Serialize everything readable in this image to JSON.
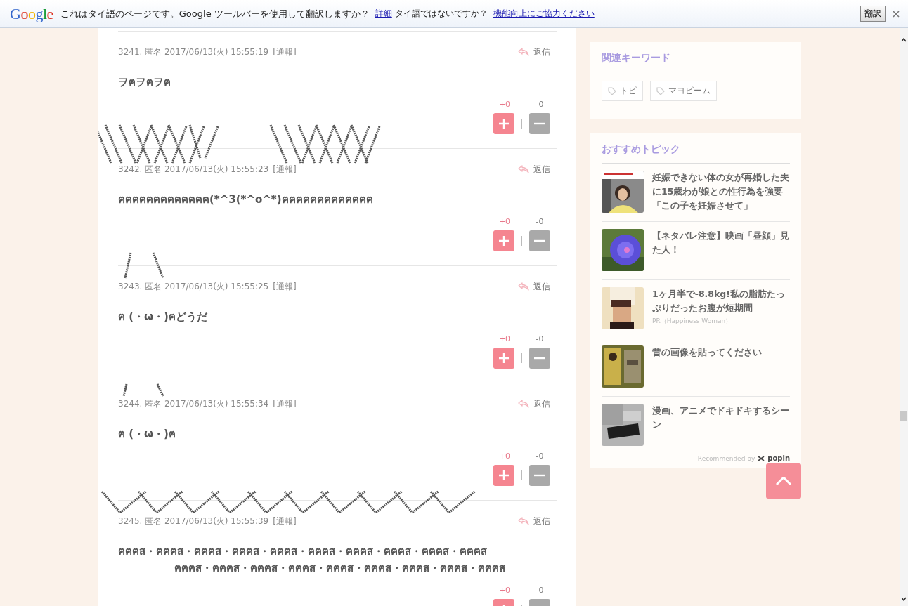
{
  "translate_bar": {
    "logo": "Google",
    "message": "これはタイ語のページです。Google ツールバーを使用して翻訳しますか？",
    "details_link": "詳細",
    "not_language": "タイ語ではないですか？",
    "feedback_link": "機能向上にご協力ください",
    "translate_button": "翻訳"
  },
  "posts": [
    {
      "meta": "3241. 匿名 2017/06/13(火) 15:55:19",
      "report": "[通報]",
      "reply": "返信",
      "body": [
        "ヲฅヲฅヲฅ"
      ],
      "plus": "+0",
      "minus": "-0"
    },
    {
      "meta": "3242. 匿名 2017/06/13(火) 15:55:23",
      "report": "[通報]",
      "reply": "返信",
      "body": [
        "ฅฅฅฅฅฅฅฅฅฅฅฅฅ(*^3(*^o^*)ฅฅฅฅฅฅฅฅฅฅฅฅฅ"
      ],
      "plus": "+0",
      "minus": "-0"
    },
    {
      "meta": "3243. 匿名 2017/06/13(火) 15:55:25",
      "report": "[通報]",
      "reply": "返信",
      "body": [
        "ฅ (・ω・)ฅどうだ"
      ],
      "plus": "+0",
      "minus": "-0"
    },
    {
      "meta": "3244. 匿名 2017/06/13(火) 15:55:34",
      "report": "[通報]",
      "reply": "返信",
      "body": [
        "ฅ (・ω・)ฅ"
      ],
      "plus": "+0",
      "minus": "-0"
    },
    {
      "meta": "3245. 匿名 2017/06/13(火) 15:55:39",
      "report": "[通報]",
      "reply": "返信",
      "body": [
        "ฅฅฅส・ฅฅฅส・ฅฅฅส・ฅฅฅส・ฅฅฅส・ฅฅฅส・ฅฅฅส・ฅฅฅส・ฅฅฅส・ฅฅฅส",
        "ฅฅฅส・ฅฅฅส・ฅฅฅส・ฅฅฅส・ฅฅฅส・ฅฅฅส・ฅฅฅส・ฅฅฅส・ฅฅฅส"
      ],
      "plus": "+0",
      "minus": "-0"
    }
  ],
  "keywords": {
    "title": "関連キーワード",
    "tags": [
      "トピ",
      "マヨビーム"
    ]
  },
  "recommended": {
    "title": "おすすめトピック",
    "items": [
      {
        "title": "妊娠できない体の女が再婚した夫に15歳わが娘との性行為を強要「この子を妊娠させて」",
        "kind": "picture"
      },
      {
        "title": "【ネタバレ注意】映画「昼顔」見た人！",
        "kind": "picture"
      },
      {
        "title": "1ヶ月半で-8.8kg!私の脂肪たっぷりだったお腹が短期間",
        "pr": "PR（Happiness Woman）",
        "kind": "picture"
      },
      {
        "title": "昔の画像を貼ってください",
        "kind": "picture"
      },
      {
        "title": "漫画、アニメでドキドキするシーン",
        "kind": "picture"
      }
    ],
    "footer": "Recommended by",
    "brand": "popin"
  }
}
